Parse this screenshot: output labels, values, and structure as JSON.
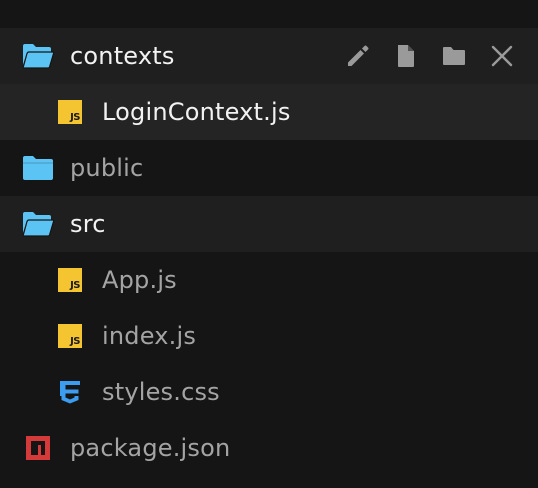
{
  "explorer": {
    "items": [
      {
        "label": "contexts",
        "type": "folder-open",
        "depth": 0
      },
      {
        "label": "LoginContext.js",
        "type": "js",
        "depth": 1
      },
      {
        "label": "public",
        "type": "folder",
        "depth": 0
      },
      {
        "label": "src",
        "type": "folder-open",
        "depth": 0
      },
      {
        "label": "App.js",
        "type": "js",
        "depth": 1
      },
      {
        "label": "index.js",
        "type": "js",
        "depth": 1
      },
      {
        "label": "styles.css",
        "type": "css",
        "depth": 1
      },
      {
        "label": "package.json",
        "type": "npm",
        "depth": 0
      }
    ],
    "js_badge_text": "JS",
    "actions": [
      "pencil-icon",
      "new-file-icon",
      "new-folder-icon",
      "close-icon"
    ]
  },
  "colors": {
    "background": "#151515",
    "row_active": "#242424",
    "row_selected": "#1f1f1f",
    "folder": "#5cc4f5",
    "js": "#f5c431",
    "css": "#3b9cf0",
    "npm": "#d43a3a",
    "action_icon": "#9a9a9a"
  }
}
